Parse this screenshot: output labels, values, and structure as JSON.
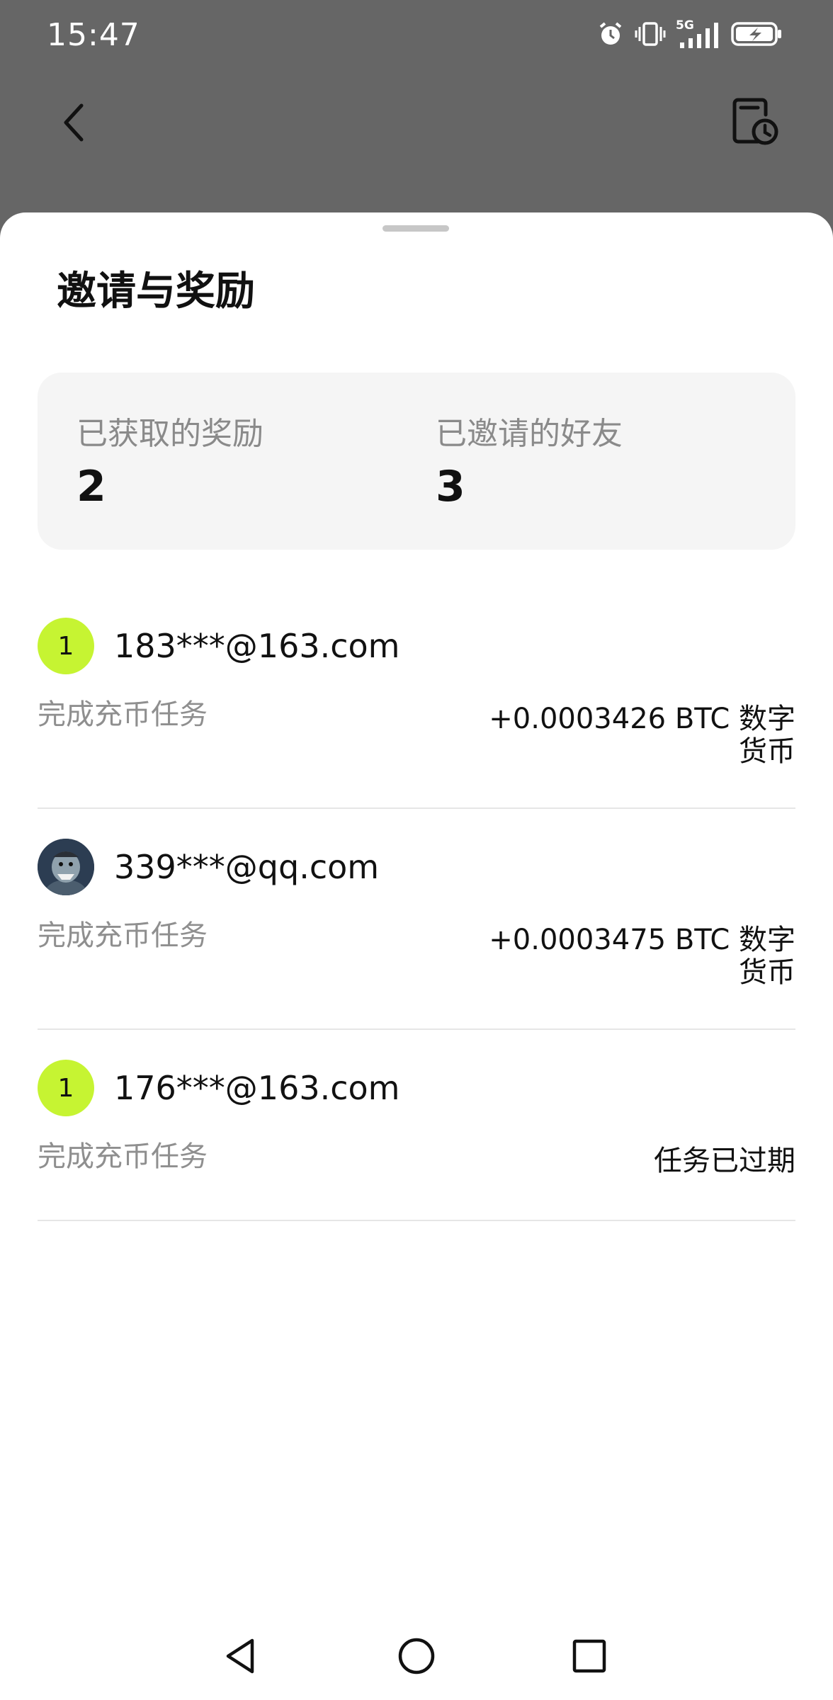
{
  "status_bar": {
    "time": "15:47",
    "network_label": "5G",
    "icons": [
      "alarm-icon",
      "vibrate-icon",
      "signal-icon",
      "battery-charging-icon"
    ]
  },
  "header": {
    "back_icon": "chevron-left-icon",
    "history_icon": "history-clock-icon"
  },
  "sheet": {
    "title": "邀请与奖励",
    "stats": {
      "rewards_label": "已获取的奖励",
      "rewards_value": "2",
      "friends_label": "已邀请的好友",
      "friends_value": "3"
    },
    "invites": [
      {
        "avatar_text": "1",
        "email": "183***@163.com",
        "task": "完成充币任务",
        "reward": "+0.0003426 BTC 数字货币"
      },
      {
        "avatar_text": "",
        "email": "339***@qq.com",
        "task": "完成充币任务",
        "reward": "+0.0003475 BTC 数字货币"
      },
      {
        "avatar_text": "1",
        "email": "176***@163.com",
        "task": "完成充币任务",
        "reward": "任务已过期"
      }
    ]
  },
  "nav": {
    "icons": [
      "nav-back-icon",
      "nav-home-icon",
      "nav-recents-icon"
    ]
  },
  "colors": {
    "accent": "#c6f432",
    "overlay": "#666666",
    "card": "#f5f5f5"
  }
}
